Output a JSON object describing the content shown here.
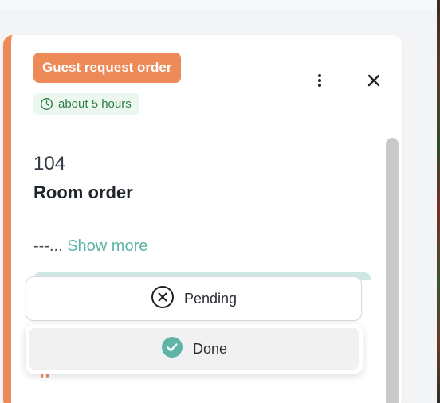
{
  "card": {
    "type_badge": "Guest request order",
    "elapsed": "about 5 hours",
    "room_number": "104",
    "title": "Room order",
    "description": "---...",
    "show_more": "Show more"
  },
  "status_button": {
    "label": "Pending",
    "icon": "x-circle-icon"
  },
  "status_menu": {
    "options": [
      {
        "label": "Done",
        "icon": "check-circle-icon"
      }
    ]
  },
  "colors": {
    "accent": "#ee8a58",
    "chip_bg": "#ecf8ef",
    "chip_text": "#2e7d4a",
    "link": "#5fb4a7",
    "done_icon": "#5fb4a7"
  }
}
